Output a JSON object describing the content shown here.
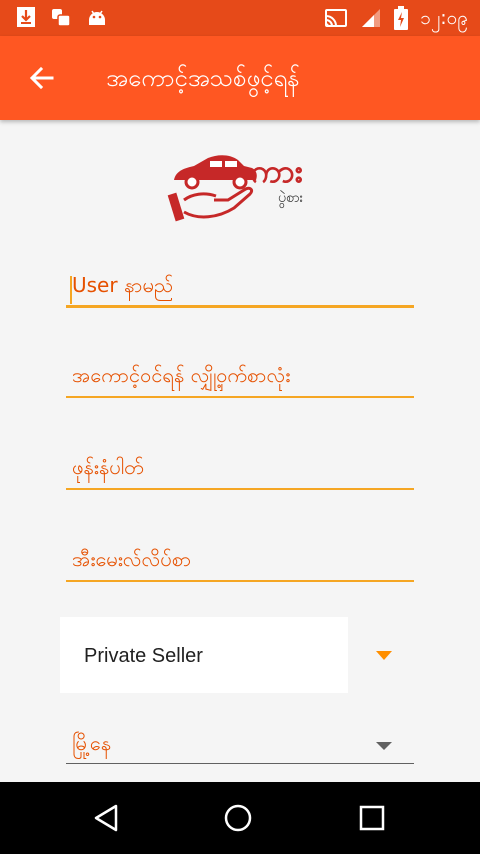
{
  "status_bar": {
    "time": "၁၂:၀၉",
    "icons": [
      "download-icon",
      "notification-app-icon",
      "android-icon",
      "cast-icon",
      "signal-icon",
      "battery-charging-icon"
    ]
  },
  "app_bar": {
    "title": "အကောင့်အသစ်ဖွင့်ရန်",
    "back_icon": "arrow-back-icon"
  },
  "logo": {
    "brand": "ကား",
    "sub": "ပွဲစား"
  },
  "form": {
    "username_placeholder": "User နာမည်",
    "password_placeholder": "အကောင့်ဝင်ရန် လျှို့ဝှက်စာလုံး",
    "phone_placeholder": "ဖုန်းနံပါတ်",
    "email_placeholder": "အီးမေးလ်လိပ်စာ",
    "seller_type_value": "Private Seller",
    "city_placeholder": "မြို့နေ"
  },
  "colors": {
    "status_bar": "#e64a19",
    "app_bar": "#ff5722",
    "accent": "#f5a623",
    "label": "#e65100",
    "logo_red": "#c62828"
  },
  "nav_bar": {
    "icons": [
      "back-triangle-icon",
      "home-circle-icon",
      "recents-square-icon"
    ]
  }
}
